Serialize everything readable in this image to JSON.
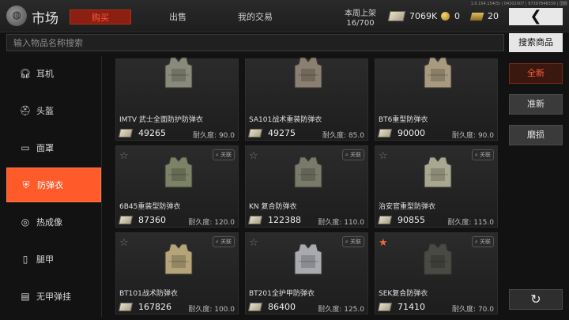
{
  "app": {
    "title": "市场",
    "version": "1.0.154.154(5) | 04302007 | 97397848339 | 国服"
  },
  "topnav": {
    "buy": "购买",
    "sell": "出售",
    "my_trades": "我的交易"
  },
  "weekly": {
    "label": "本周上架",
    "count": "16/700"
  },
  "currency": {
    "cash": "7069K",
    "coin": "0",
    "bar": "20"
  },
  "search": {
    "placeholder": "输入物品名称搜索",
    "button": "搜索商品"
  },
  "sidebar": {
    "items": [
      {
        "label": "耳机",
        "icon": "headphones-icon"
      },
      {
        "label": "头盔",
        "icon": "helmet-icon"
      },
      {
        "label": "面罩",
        "icon": "mask-icon"
      },
      {
        "label": "防弹衣",
        "icon": "vest-icon",
        "active": true
      },
      {
        "label": "热成像",
        "icon": "thermal-icon"
      },
      {
        "label": "腿甲",
        "icon": "leg-armor-icon"
      },
      {
        "label": "无甲弹挂",
        "icon": "rig-icon"
      }
    ]
  },
  "filters": {
    "new": "全新",
    "like_new": "准新",
    "worn": "磨损"
  },
  "card_labels": {
    "link": "关联",
    "durability": "耐久度:"
  },
  "items": [
    {
      "name": "IMTV 武士全面防护防弹衣",
      "price": "49265",
      "durability": "90.0",
      "color": "#8a8a7a"
    },
    {
      "name": "SA101战术重装防弹衣",
      "price": "49275",
      "durability": "85.0",
      "color": "#8a7f70"
    },
    {
      "name": "BT6重型防弹衣",
      "price": "90000",
      "durability": "90.0",
      "color": "#a89a7e"
    },
    {
      "name": "6B45重装型防弹衣",
      "price": "87360",
      "durability": "120.0",
      "color": "#7c8266"
    },
    {
      "name": "KN 复合防弹衣",
      "price": "122388",
      "durability": "110.0",
      "color": "#7a7a6a"
    },
    {
      "name": "治安官重型防弹衣",
      "price": "90855",
      "durability": "115.0",
      "color": "#a8a890"
    },
    {
      "name": "BT101战术防弹衣",
      "price": "167826",
      "durability": "100.0",
      "color": "#b4a478"
    },
    {
      "name": "BT201全护甲防弹衣",
      "price": "86400",
      "durability": "125.0",
      "color": "#a8aab0"
    },
    {
      "name": "SEK复合防弹衣",
      "price": "71410",
      "durability": "70.0",
      "color": "#4a4a44",
      "favorite": true
    }
  ]
}
